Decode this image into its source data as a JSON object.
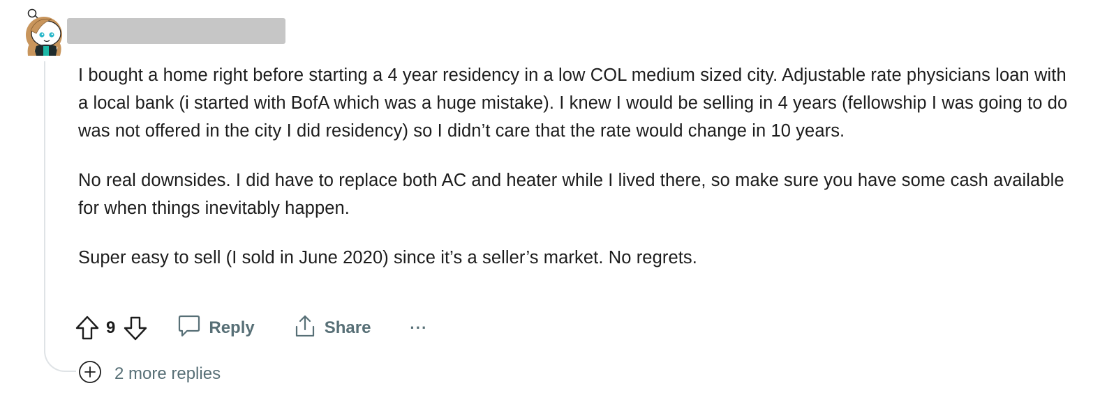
{
  "comment": {
    "username_redacted": true,
    "paragraphs": [
      "I bought a home right before starting a 4 year residency in a low COL medium sized city. Adjustable rate physicians loan with a local bank (i started with BofA which was a huge mistake). I knew I would be selling in 4 years (fellowship I was going to do was not offered in the city I did residency) so I didn’t care that the rate would change in 10 years.",
      "No real downsides. I did have to replace both AC and heater while I lived there, so make sure you have some cash available for when things inevitably happen.",
      "Super easy to sell (I sold in June 2020) since it’s a seller’s market. No regrets."
    ],
    "vote_count": "9",
    "actions": {
      "reply_label": "Reply",
      "share_label": "Share",
      "more_label": "···"
    },
    "more_replies_label": "2 more replies"
  },
  "icons": {
    "upvote": "arrow-up-outline-icon",
    "downvote": "arrow-down-outline-icon",
    "reply": "speech-bubble-icon",
    "share": "share-upload-icon",
    "expand": "plus-circle-icon",
    "avatar": "snoo-avatar"
  },
  "colors": {
    "text": "#1c1c1c",
    "muted": "#576f76",
    "thread_line": "#dfe3e6",
    "redaction": "#c6c6c6"
  }
}
